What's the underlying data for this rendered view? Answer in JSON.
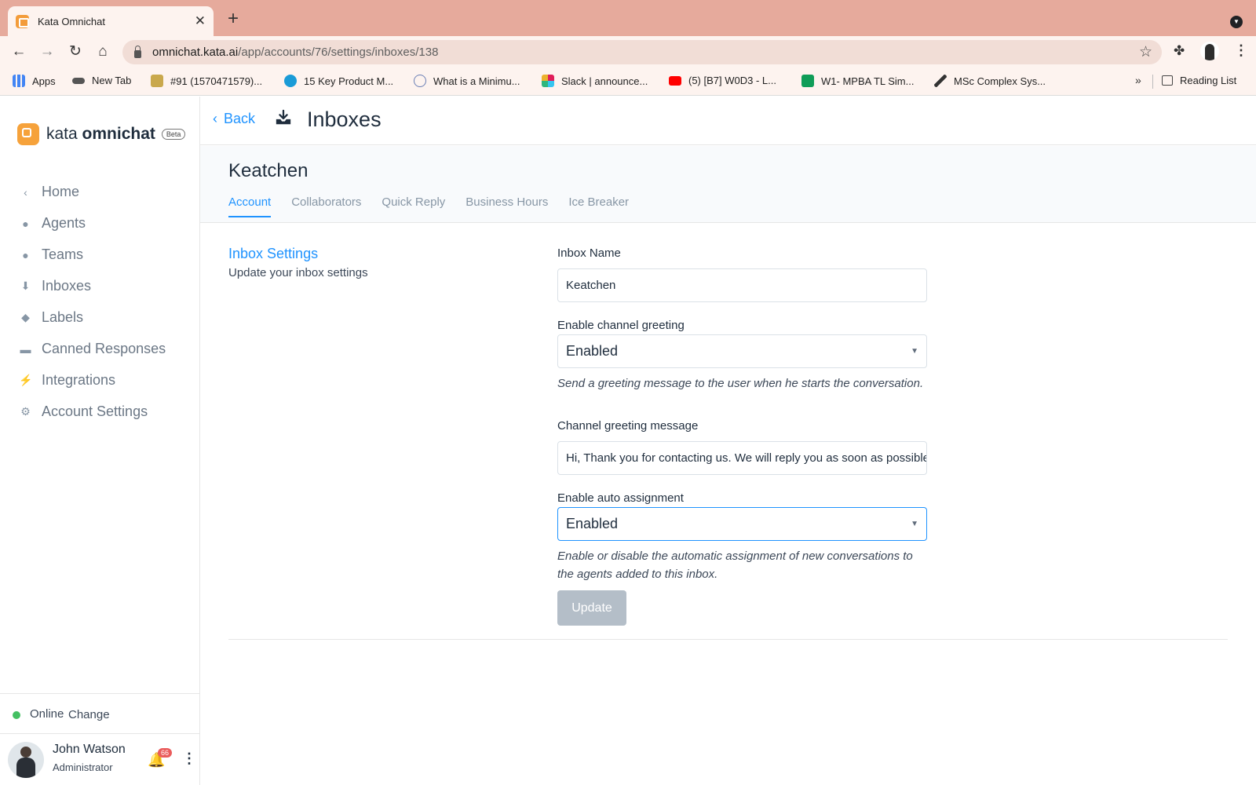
{
  "browser": {
    "tab_title": "Kata Omnichat",
    "url_host": "omnichat.kata.ai",
    "url_path": "/app/accounts/76/settings/inboxes/138",
    "bookmarks": [
      {
        "label": "Apps",
        "color": "#4285f4"
      },
      {
        "label": "New Tab",
        "color": "#333333"
      },
      {
        "label": "#91 (1570471579)...",
        "color": "#a0822d"
      },
      {
        "label": "15 Key Product M...",
        "color": "#1a9bd7"
      },
      {
        "label": "What is a Minimu...",
        "color": "#6a7fb5"
      },
      {
        "label": "Slack | announce...",
        "color": "#e01e5a"
      },
      {
        "label": "(5) [B7] W0D3 - L...",
        "color": "#ff0000"
      },
      {
        "label": "W1- MPBA TL Sim...",
        "color": "#0f9d58"
      },
      {
        "label": "MSc Complex Sys...",
        "color": "#333333"
      }
    ],
    "more_bookmarks": "»",
    "reading_list": "Reading List"
  },
  "sidebar": {
    "brand_light": "kata ",
    "brand_bold": "omnichat",
    "beta": "Beta",
    "items": [
      {
        "label": "Home",
        "icon": "chevron-left-icon"
      },
      {
        "label": "Agents",
        "icon": "agents-icon"
      },
      {
        "label": "Teams",
        "icon": "teams-icon"
      },
      {
        "label": "Inboxes",
        "icon": "inbox-icon"
      },
      {
        "label": "Labels",
        "icon": "tag-icon"
      },
      {
        "label": "Canned Responses",
        "icon": "chat-icon"
      },
      {
        "label": "Integrations",
        "icon": "bolt-icon"
      },
      {
        "label": "Account Settings",
        "icon": "gear-icon"
      }
    ],
    "status": "Online",
    "status_change": "Change",
    "user_name": "John Watson",
    "user_role": "Administrator",
    "notification_count": "66"
  },
  "header": {
    "back": "Back",
    "title": "Inboxes"
  },
  "inbox": {
    "name": "Keatchen",
    "tabs": [
      "Account",
      "Collaborators",
      "Quick Reply",
      "Business Hours",
      "Ice Breaker"
    ],
    "active_tab": "Account"
  },
  "settings": {
    "section_title": "Inbox Settings",
    "section_desc": "Update your inbox settings",
    "inbox_name_label": "Inbox Name",
    "inbox_name_value": "Keatchen",
    "greeting_label": "Enable channel greeting",
    "greeting_value": "Enabled",
    "greeting_help": "Send a greeting message to the user when he starts the conversation.",
    "greeting_message_label": "Channel greeting message",
    "greeting_message_value": "Hi, Thank you for contacting us. We will reply you as soon as possible.",
    "auto_assign_label": "Enable auto assignment",
    "auto_assign_value": "Enabled",
    "auto_assign_help": "Enable or disable the automatic assignment of new conversations to the agents added to this inbox.",
    "update_button": "Update"
  },
  "colors": {
    "accent": "#1f93ff",
    "brand": "#f6a23b",
    "online": "#44c062",
    "badge": "#ea5c5c"
  }
}
